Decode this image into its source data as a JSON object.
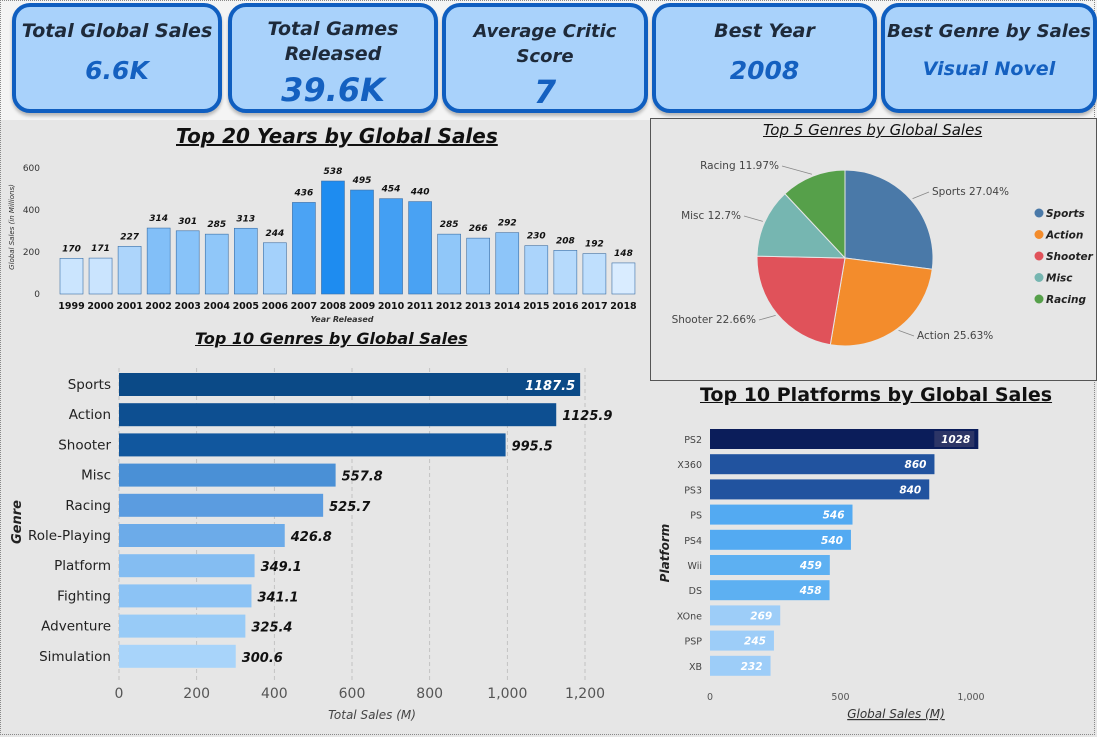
{
  "kpis": [
    {
      "label": "Total Global Sales",
      "value": "6.6K"
    },
    {
      "label": "Total Games Released",
      "value": "39.6K"
    },
    {
      "label": "Average Critic Score",
      "value": "7"
    },
    {
      "label": "Best Year",
      "value": "2008"
    },
    {
      "label": "Best Genre by Sales",
      "value": "Visual Novel"
    }
  ],
  "colors": {
    "kpi_border": "#0f5ec0",
    "kpi_fill": "#a9d2fb",
    "kpi_value": "#1460c0"
  },
  "chart_data": [
    {
      "id": "years",
      "type": "bar",
      "title": "Top 20 Years by Global Sales",
      "xlabel": "Year Released",
      "ylabel": "Global Sales (in Millions)",
      "categories": [
        "1999",
        "2000",
        "2001",
        "2002",
        "2003",
        "2004",
        "2005",
        "2006",
        "2007",
        "2008",
        "2009",
        "2010",
        "2011",
        "2012",
        "2013",
        "2014",
        "2015",
        "2016",
        "2017",
        "2018"
      ],
      "values": [
        170,
        171,
        227,
        314,
        301,
        285,
        313,
        244,
        436,
        538,
        495,
        454,
        440,
        285,
        266,
        292,
        230,
        208,
        192,
        148
      ],
      "yticks": [
        "0",
        "200",
        "400",
        "600"
      ],
      "ylim": [
        0,
        600
      ]
    },
    {
      "id": "pie",
      "type": "pie",
      "title": "Top 5 Genres by Global Sales",
      "slices": [
        {
          "name": "Sports",
          "pct": 27.04,
          "label": "Sports 27.04%",
          "color": "#4a79a8"
        },
        {
          "name": "Action",
          "pct": 25.63,
          "label": "Action 25.63%",
          "color": "#f38c2c"
        },
        {
          "name": "Shooter",
          "pct": 22.66,
          "label": "Shooter 22.66%",
          "color": "#e0525a"
        },
        {
          "name": "Misc",
          "pct": 12.7,
          "label": "Misc 12.7%",
          "color": "#76b6b1"
        },
        {
          "name": "Racing",
          "pct": 11.97,
          "label": "Racing 11.97%",
          "color": "#56a04a"
        }
      ],
      "legend_position": "right"
    },
    {
      "id": "genres",
      "type": "bar",
      "orientation": "horizontal",
      "title": "Top 10 Genres by Global Sales",
      "xlabel": "Total Sales (M)",
      "ylabel": "Genre",
      "categories": [
        "Sports",
        "Action",
        "Shooter",
        "Misc",
        "Racing",
        "Role-Playing",
        "Platform",
        "Fighting",
        "Adventure",
        "Simulation"
      ],
      "values": [
        1187.5,
        1125.9,
        995.5,
        557.8,
        525.7,
        426.8,
        349.1,
        341.1,
        325.4,
        300.6
      ],
      "labels": [
        "1187.5",
        "1125.9",
        "995.5",
        "557.8",
        "525.7",
        "426.8",
        "349.1",
        "341.1",
        "325.4",
        "300.6"
      ],
      "xticks": [
        "0",
        "200",
        "400",
        "600",
        "800",
        "1,000",
        "1,200"
      ],
      "xlim": [
        0,
        1200
      ],
      "grid": true
    },
    {
      "id": "platforms",
      "type": "bar",
      "orientation": "horizontal",
      "title": "Top 10 Platforms by Global Sales",
      "xlabel": "Global Sales (M)",
      "ylabel": "Platform",
      "categories": [
        "PS2",
        "X360",
        "PS3",
        "PS",
        "PS4",
        "Wii",
        "DS",
        "XOne",
        "PSP",
        "XB"
      ],
      "values": [
        1028,
        860,
        840,
        546,
        540,
        459,
        458,
        269,
        245,
        232
      ],
      "labels": [
        "1028",
        "860",
        "840",
        "546",
        "540",
        "459",
        "458",
        "269",
        "245",
        "232"
      ],
      "xticks": [
        "0",
        "500",
        "1,000"
      ],
      "xlim": [
        0,
        1000
      ]
    }
  ]
}
